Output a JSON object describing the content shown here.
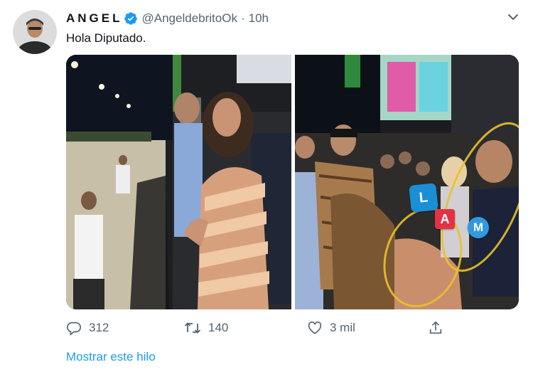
{
  "author": {
    "name": "ANGEL",
    "handle": "@AngeldebritoOk",
    "separator": "·",
    "time": "10h",
    "verified": true
  },
  "tweet": {
    "text": "Hola Diputado."
  },
  "media": {
    "overlay": {
      "badge_l": "L",
      "badge_a": "A",
      "badge_m": "M"
    },
    "photo_count": 2
  },
  "actions": {
    "replies": "312",
    "retweets": "140",
    "likes": "3 mil"
  },
  "thread_link": "Mostrar este hilo",
  "colors": {
    "accent": "#1d9bf0",
    "text": "#0f1419",
    "secondary": "#536471",
    "highlight_circle": "#e8c12f"
  }
}
